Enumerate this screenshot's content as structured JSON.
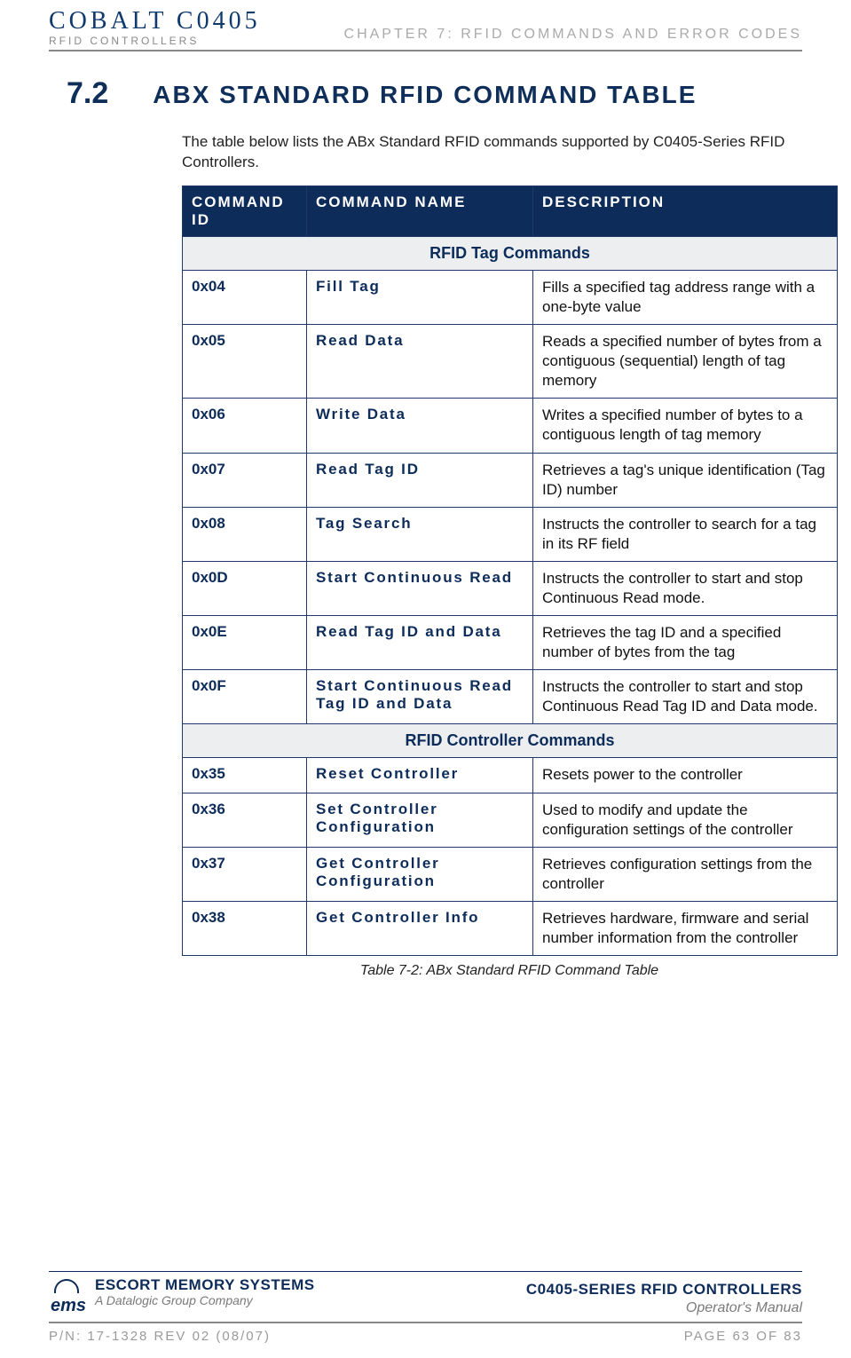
{
  "header": {
    "brand_top": "COBALT C0405",
    "brand_sub": "RFID CONTROLLERS",
    "chapter_label": "CHAPTER 7: RFID COMMANDS AND ERROR CODES"
  },
  "section": {
    "number": "7.2",
    "title": "ABX STANDARD RFID COMMAND TABLE",
    "intro": "The table below lists the ABx Standard RFID commands supported by C0405-Series RFID Controllers."
  },
  "table": {
    "headers": {
      "id": "COMMAND ID",
      "name": "COMMAND NAME",
      "desc": "DESCRIPTION"
    },
    "section1_label": "RFID Tag Commands",
    "section1_rows": [
      {
        "id": "0x04",
        "name": "Fill Tag",
        "desc": "Fills a specified tag address range with a one-byte value"
      },
      {
        "id": "0x05",
        "name": "Read Data",
        "desc": "Reads a specified number of bytes from a contiguous (sequential) length of tag memory"
      },
      {
        "id": "0x06",
        "name": "Write Data",
        "desc": "Writes a specified number of bytes to a contiguous length of tag memory"
      },
      {
        "id": "0x07",
        "name": "Read Tag ID",
        "desc": "Retrieves a tag's unique identification (Tag ID) number"
      },
      {
        "id": "0x08",
        "name": "Tag Search",
        "desc": "Instructs the controller to search for a tag in its RF field"
      },
      {
        "id": "0x0D",
        "name": "Start Continuous Read",
        "desc": "Instructs the controller to start and stop Continuous Read mode."
      },
      {
        "id": "0x0E",
        "name": "Read Tag ID and Data",
        "desc": "Retrieves the tag ID and a specified number of bytes from the tag"
      },
      {
        "id": "0x0F",
        "name": "Start Continuous Read Tag ID and Data",
        "desc": "Instructs the controller to start and stop Continuous Read Tag ID and Data mode."
      }
    ],
    "section2_label": "RFID Controller Commands",
    "section2_rows": [
      {
        "id": "0x35",
        "name": "Reset Controller",
        "desc": "Resets power to the controller"
      },
      {
        "id": "0x36",
        "name": "Set Controller Configuration",
        "desc": "Used to modify and update the configuration settings of the controller"
      },
      {
        "id": "0x37",
        "name": "Get Controller Configuration",
        "desc": "Retrieves configuration settings from the controller"
      },
      {
        "id": "0x38",
        "name": "Get Controller Info",
        "desc": "Retrieves hardware, firmware and serial number information from the controller"
      }
    ],
    "caption": "Table 7-2: ABx Standard RFID Command Table"
  },
  "footer": {
    "ems_logo_text": "ems",
    "ems_line1": "ESCORT MEMORY SYSTEMS",
    "ems_line2": "A Datalogic Group Company",
    "fr_line1": "C0405-SERIES RFID CONTROLLERS",
    "fr_line2": "Operator's Manual",
    "pn": "P/N: 17-1328 REV 02 (08/07)",
    "page": "PAGE 63 OF 83"
  }
}
